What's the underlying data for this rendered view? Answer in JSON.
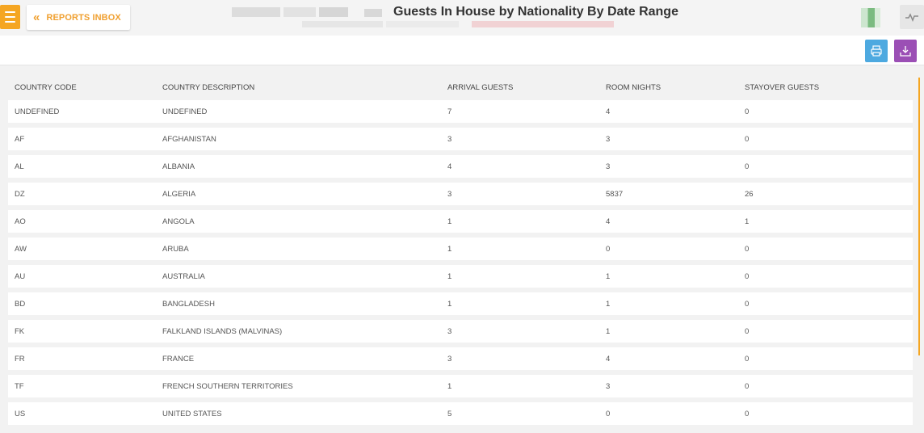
{
  "header": {
    "back_label": "REPORTS INBOX",
    "title": "Guests In House by Nationality By Date Range"
  },
  "colors": {
    "accent": "#f5a623",
    "print_button": "#4da9e0",
    "download_button": "#9b4fb5"
  },
  "icons": {
    "menu": "hamburger-icon",
    "back": "double-chevron-left-icon",
    "activity": "pulse-icon",
    "print": "printer-icon",
    "download": "download-icon"
  },
  "table": {
    "columns": [
      "COUNTRY CODE",
      "COUNTRY DESCRIPTION",
      "ARRIVAL GUESTS",
      "ROOM NIGHTS",
      "STAYOVER GUESTS"
    ],
    "rows": [
      [
        "UNDEFINED",
        "UNDEFINED",
        "7",
        "4",
        "0"
      ],
      [
        "AF",
        "AFGHANISTAN",
        "3",
        "3",
        "0"
      ],
      [
        "AL",
        "ALBANIA",
        "4",
        "3",
        "0"
      ],
      [
        "DZ",
        "ALGERIA",
        "3",
        "5837",
        "26"
      ],
      [
        "AO",
        "ANGOLA",
        "1",
        "4",
        "1"
      ],
      [
        "AW",
        "ARUBA",
        "1",
        "0",
        "0"
      ],
      [
        "AU",
        "AUSTRALIA",
        "1",
        "1",
        "0"
      ],
      [
        "BD",
        "BANGLADESH",
        "1",
        "1",
        "0"
      ],
      [
        "FK",
        "FALKLAND ISLANDS (MALVINAS)",
        "3",
        "1",
        "0"
      ],
      [
        "FR",
        "FRANCE",
        "3",
        "4",
        "0"
      ],
      [
        "TF",
        "FRENCH SOUTHERN TERRITORIES",
        "1",
        "3",
        "0"
      ],
      [
        "US",
        "UNITED STATES",
        "5",
        "0",
        "0"
      ]
    ]
  }
}
